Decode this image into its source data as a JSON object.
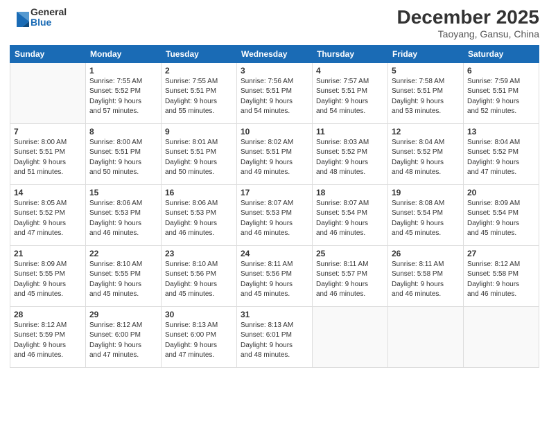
{
  "header": {
    "logo_general": "General",
    "logo_blue": "Blue",
    "month": "December 2025",
    "location": "Taoyang, Gansu, China"
  },
  "weekdays": [
    "Sunday",
    "Monday",
    "Tuesday",
    "Wednesday",
    "Thursday",
    "Friday",
    "Saturday"
  ],
  "weeks": [
    [
      {
        "day": "",
        "content": ""
      },
      {
        "day": "1",
        "content": "Sunrise: 7:55 AM\nSunset: 5:52 PM\nDaylight: 9 hours\nand 57 minutes."
      },
      {
        "day": "2",
        "content": "Sunrise: 7:55 AM\nSunset: 5:51 PM\nDaylight: 9 hours\nand 55 minutes."
      },
      {
        "day": "3",
        "content": "Sunrise: 7:56 AM\nSunset: 5:51 PM\nDaylight: 9 hours\nand 54 minutes."
      },
      {
        "day": "4",
        "content": "Sunrise: 7:57 AM\nSunset: 5:51 PM\nDaylight: 9 hours\nand 54 minutes."
      },
      {
        "day": "5",
        "content": "Sunrise: 7:58 AM\nSunset: 5:51 PM\nDaylight: 9 hours\nand 53 minutes."
      },
      {
        "day": "6",
        "content": "Sunrise: 7:59 AM\nSunset: 5:51 PM\nDaylight: 9 hours\nand 52 minutes."
      }
    ],
    [
      {
        "day": "7",
        "content": "Sunrise: 8:00 AM\nSunset: 5:51 PM\nDaylight: 9 hours\nand 51 minutes."
      },
      {
        "day": "8",
        "content": "Sunrise: 8:00 AM\nSunset: 5:51 PM\nDaylight: 9 hours\nand 50 minutes."
      },
      {
        "day": "9",
        "content": "Sunrise: 8:01 AM\nSunset: 5:51 PM\nDaylight: 9 hours\nand 50 minutes."
      },
      {
        "day": "10",
        "content": "Sunrise: 8:02 AM\nSunset: 5:51 PM\nDaylight: 9 hours\nand 49 minutes."
      },
      {
        "day": "11",
        "content": "Sunrise: 8:03 AM\nSunset: 5:52 PM\nDaylight: 9 hours\nand 48 minutes."
      },
      {
        "day": "12",
        "content": "Sunrise: 8:04 AM\nSunset: 5:52 PM\nDaylight: 9 hours\nand 48 minutes."
      },
      {
        "day": "13",
        "content": "Sunrise: 8:04 AM\nSunset: 5:52 PM\nDaylight: 9 hours\nand 47 minutes."
      }
    ],
    [
      {
        "day": "14",
        "content": "Sunrise: 8:05 AM\nSunset: 5:52 PM\nDaylight: 9 hours\nand 47 minutes."
      },
      {
        "day": "15",
        "content": "Sunrise: 8:06 AM\nSunset: 5:53 PM\nDaylight: 9 hours\nand 46 minutes."
      },
      {
        "day": "16",
        "content": "Sunrise: 8:06 AM\nSunset: 5:53 PM\nDaylight: 9 hours\nand 46 minutes."
      },
      {
        "day": "17",
        "content": "Sunrise: 8:07 AM\nSunset: 5:53 PM\nDaylight: 9 hours\nand 46 minutes."
      },
      {
        "day": "18",
        "content": "Sunrise: 8:07 AM\nSunset: 5:54 PM\nDaylight: 9 hours\nand 46 minutes."
      },
      {
        "day": "19",
        "content": "Sunrise: 8:08 AM\nSunset: 5:54 PM\nDaylight: 9 hours\nand 45 minutes."
      },
      {
        "day": "20",
        "content": "Sunrise: 8:09 AM\nSunset: 5:54 PM\nDaylight: 9 hours\nand 45 minutes."
      }
    ],
    [
      {
        "day": "21",
        "content": "Sunrise: 8:09 AM\nSunset: 5:55 PM\nDaylight: 9 hours\nand 45 minutes."
      },
      {
        "day": "22",
        "content": "Sunrise: 8:10 AM\nSunset: 5:55 PM\nDaylight: 9 hours\nand 45 minutes."
      },
      {
        "day": "23",
        "content": "Sunrise: 8:10 AM\nSunset: 5:56 PM\nDaylight: 9 hours\nand 45 minutes."
      },
      {
        "day": "24",
        "content": "Sunrise: 8:11 AM\nSunset: 5:56 PM\nDaylight: 9 hours\nand 45 minutes."
      },
      {
        "day": "25",
        "content": "Sunrise: 8:11 AM\nSunset: 5:57 PM\nDaylight: 9 hours\nand 46 minutes."
      },
      {
        "day": "26",
        "content": "Sunrise: 8:11 AM\nSunset: 5:58 PM\nDaylight: 9 hours\nand 46 minutes."
      },
      {
        "day": "27",
        "content": "Sunrise: 8:12 AM\nSunset: 5:58 PM\nDaylight: 9 hours\nand 46 minutes."
      }
    ],
    [
      {
        "day": "28",
        "content": "Sunrise: 8:12 AM\nSunset: 5:59 PM\nDaylight: 9 hours\nand 46 minutes."
      },
      {
        "day": "29",
        "content": "Sunrise: 8:12 AM\nSunset: 6:00 PM\nDaylight: 9 hours\nand 47 minutes."
      },
      {
        "day": "30",
        "content": "Sunrise: 8:13 AM\nSunset: 6:00 PM\nDaylight: 9 hours\nand 47 minutes."
      },
      {
        "day": "31",
        "content": "Sunrise: 8:13 AM\nSunset: 6:01 PM\nDaylight: 9 hours\nand 48 minutes."
      },
      {
        "day": "",
        "content": ""
      },
      {
        "day": "",
        "content": ""
      },
      {
        "day": "",
        "content": ""
      }
    ]
  ]
}
